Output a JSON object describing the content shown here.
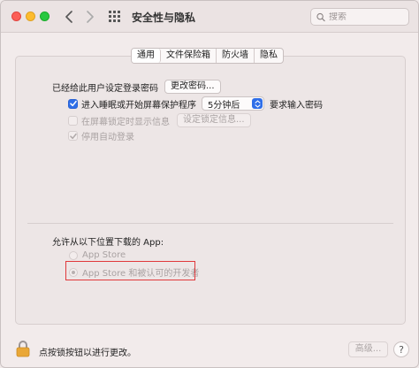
{
  "window": {
    "title": "安全性与隐私"
  },
  "search": {
    "placeholder": "搜索",
    "value": ""
  },
  "tabs": [
    {
      "label": "通用",
      "active": true
    },
    {
      "label": "文件保险箱",
      "active": false
    },
    {
      "label": "防火墙",
      "active": false
    },
    {
      "label": "隐私",
      "active": false
    }
  ],
  "general": {
    "password_label": "已经给此用户设定登录密码",
    "change_password_button": "更改密码...",
    "require_password": {
      "label": "进入睡眠或开始屏幕保护程序",
      "checked": true,
      "delay_value": "5分钟后",
      "suffix": "要求输入密码"
    },
    "show_message": {
      "label": "在屏幕锁定时显示信息",
      "checked": false,
      "button": "设定锁定信息..."
    },
    "disable_autologin": {
      "label": "停用自动登录",
      "checked": true
    }
  },
  "downloads": {
    "title": "允许从以下位置下载的 App:",
    "options": [
      {
        "label": "App Store",
        "selected": false
      },
      {
        "label": "App Store 和被认可的开发者",
        "selected": true
      }
    ]
  },
  "footer": {
    "lock_text": "点按锁按钮以进行更改。",
    "advanced_button": "高级...",
    "help_button": "?"
  },
  "colors": {
    "accent": "#2f6ee8",
    "highlight_border": "#e0383b"
  }
}
